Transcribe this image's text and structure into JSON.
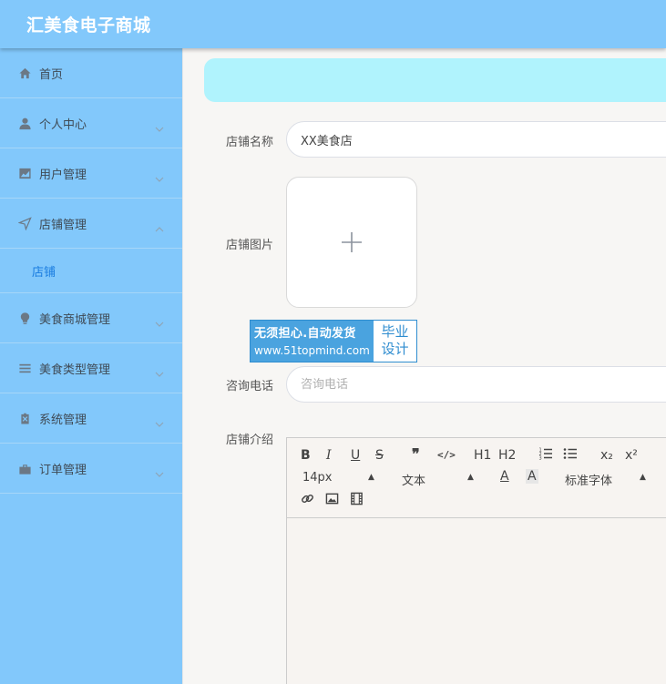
{
  "header": {
    "app_title": "汇美食电子商城"
  },
  "sidebar": {
    "items": [
      {
        "label": "首页",
        "icon": "home-icon"
      },
      {
        "label": "个人中心",
        "icon": "user-icon"
      },
      {
        "label": "用户管理",
        "icon": "chart-icon"
      },
      {
        "label": "店铺管理",
        "icon": "navigation-icon",
        "expanded": true,
        "sub_items": [
          {
            "label": "店铺",
            "active": true
          }
        ]
      },
      {
        "label": "美食商城管理",
        "icon": "bulb-icon"
      },
      {
        "label": "美食类型管理",
        "icon": "list-icon"
      },
      {
        "label": "系统管理",
        "icon": "clipboard-icon"
      },
      {
        "label": "订单管理",
        "icon": "briefcase-icon"
      }
    ]
  },
  "form": {
    "name_label": "店铺名称",
    "name_value": "XX美食店",
    "image_label": "店铺图片",
    "phone_label": "咨询电话",
    "phone_placeholder": "咨询电话",
    "intro_label": "店铺介绍"
  },
  "watermark": {
    "line1": "无须担心.自动发货",
    "line2": "www.51topmind.com",
    "right_line1": "毕业",
    "right_line2": "设计"
  },
  "editor": {
    "font_size": "14px",
    "block_type": "文本",
    "font_family": "标准字体",
    "buttons": [
      "B",
      "I",
      "U",
      "S",
      "❞",
      "</>",
      "H1",
      "H2",
      "ordered-list",
      "bullet-list",
      "x₂",
      "x²"
    ]
  },
  "colors": {
    "header_bg": "#82c8fb",
    "sidebar_bg": "#82c8fb",
    "active_sub": "#1a7de0",
    "banner_bg": "#b0f3fd"
  }
}
